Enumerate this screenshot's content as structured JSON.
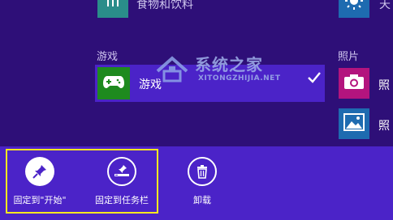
{
  "apps_view": {
    "top_items": [
      {
        "label": "食物和饮料",
        "icon": "food-drink-icon"
      },
      {
        "label": "天",
        "icon": "weather-sun-icon"
      }
    ],
    "groups": [
      {
        "header": "游戏",
        "items": [
          {
            "label": "游戏",
            "icon": "xbox-games-icon",
            "selected": true
          }
        ]
      },
      {
        "header": "照片",
        "items": [
          {
            "label": "照",
            "icon": "camera-icon"
          },
          {
            "label": "照",
            "icon": "photos-icon"
          }
        ]
      }
    ],
    "watermark": {
      "title": "系统之家",
      "url": "XITONGZHIJIA.NET"
    }
  },
  "app_bar": {
    "commands": [
      {
        "label": "固定到\"开始\"",
        "icon": "pin-icon"
      },
      {
        "label": "固定到任务栏",
        "icon": "pin-to-taskbar-icon"
      },
      {
        "label": "卸载",
        "icon": "trash-icon"
      }
    ]
  },
  "colors": {
    "background": "#2e0f78",
    "app_bar": "#4b23c8",
    "selection": "#4b23c8",
    "xbox_tile": "#1e8a1e",
    "camera_tile": "#b3147e",
    "photos_tile": "#1e6bb0",
    "food_tile": "#2a8d8a",
    "highlight_frame": "#ffe81f"
  }
}
